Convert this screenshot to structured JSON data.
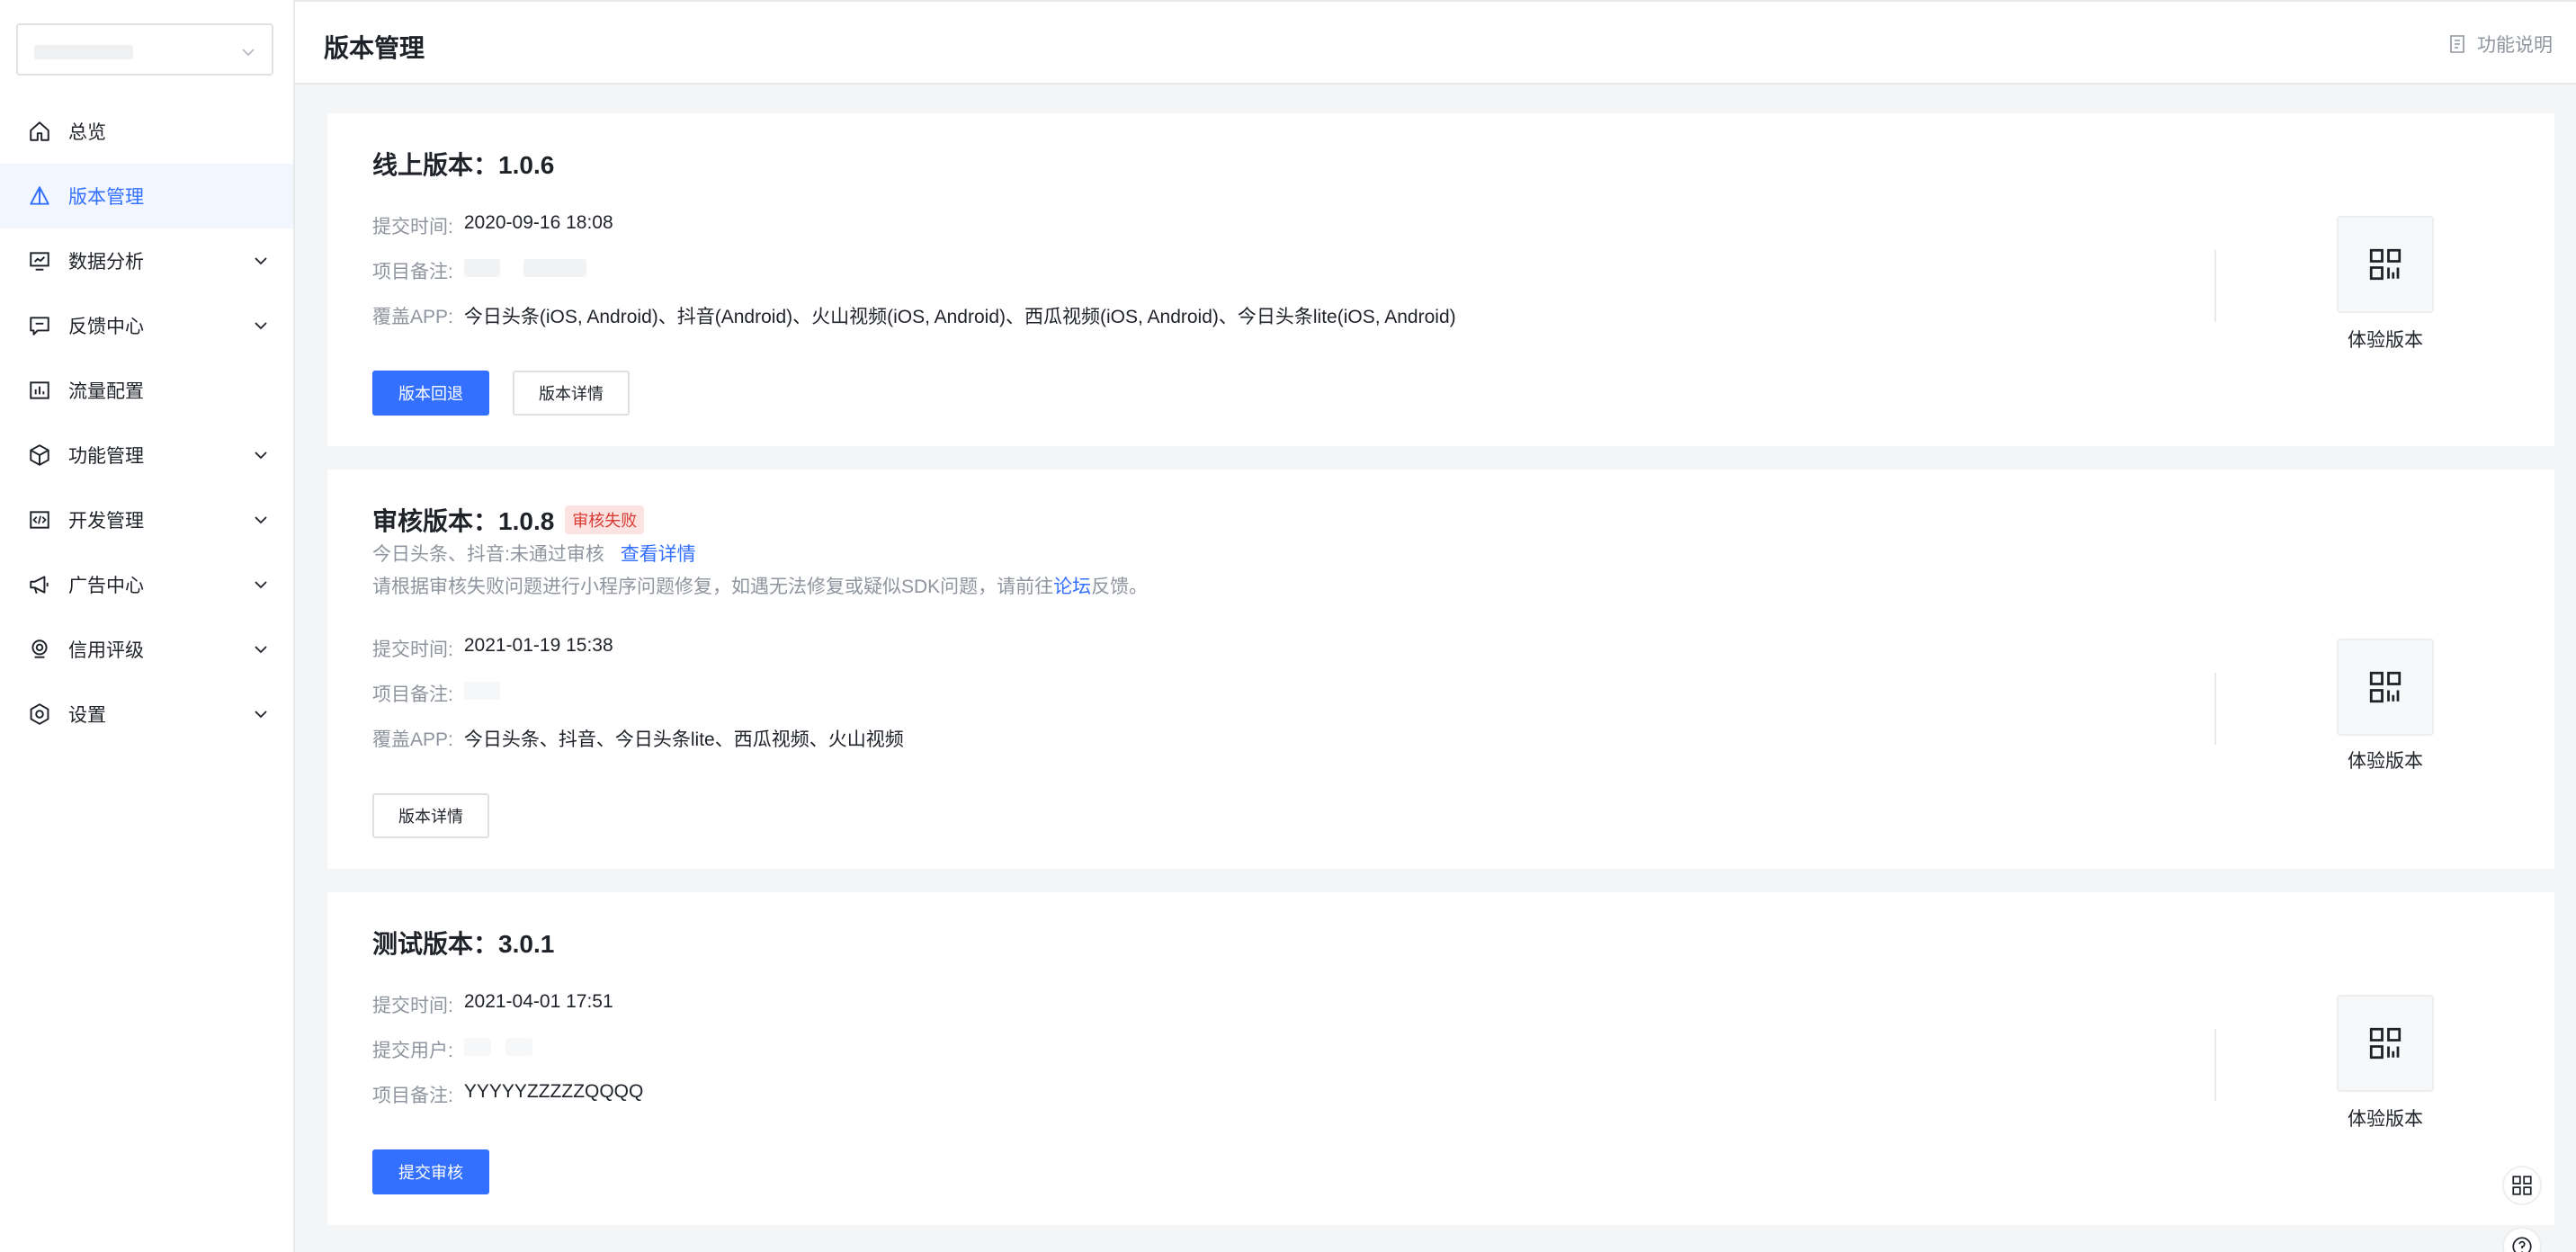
{
  "sidebar": {
    "items": [
      {
        "label": "总览",
        "icon": "home-icon",
        "active": false,
        "expandable": false
      },
      {
        "label": "版本管理",
        "icon": "version-icon",
        "active": true,
        "expandable": false
      },
      {
        "label": "数据分析",
        "icon": "analytics-icon",
        "active": false,
        "expandable": true
      },
      {
        "label": "反馈中心",
        "icon": "feedback-icon",
        "active": false,
        "expandable": true
      },
      {
        "label": "流量配置",
        "icon": "traffic-icon",
        "active": false,
        "expandable": false
      },
      {
        "label": "功能管理",
        "icon": "box-icon",
        "active": false,
        "expandable": true
      },
      {
        "label": "开发管理",
        "icon": "code-icon",
        "active": false,
        "expandable": true
      },
      {
        "label": "广告中心",
        "icon": "megaphone-icon",
        "active": false,
        "expandable": true
      },
      {
        "label": "信用评级",
        "icon": "badge-icon",
        "active": false,
        "expandable": true
      },
      {
        "label": "设置",
        "icon": "gear-icon",
        "active": false,
        "expandable": true
      }
    ]
  },
  "header": {
    "title": "版本管理",
    "help_label": "功能说明"
  },
  "online": {
    "title_prefix": "线上版本：",
    "version": "1.0.6",
    "submit_time_key": "提交时间:",
    "submit_time": "2020-09-16 18:08",
    "remark_key": "项目备注:",
    "apps_key": "覆盖APP:",
    "apps": "今日头条(iOS, Android)、抖音(Android)、火山视频(iOS, Android)、西瓜视频(iOS, Android)、今日头条lite(iOS, Android)",
    "rollback_label": "版本回退",
    "detail_label": "版本详情",
    "qr_label": "体验版本"
  },
  "review": {
    "title_prefix": "审核版本：",
    "version": "1.0.8",
    "badge": "审核失败",
    "fail_note": "今日头条、抖音:未通过审核",
    "view_detail": "查看详情",
    "advice_prefix": "请根据审核失败问题进行小程序问题修复，如遇无法修复或疑似SDK问题，请前往",
    "forum": "论坛",
    "advice_suffix": "反馈。",
    "submit_time_key": "提交时间:",
    "submit_time": "2021-01-19 15:38",
    "remark_key": "项目备注:",
    "apps_key": "覆盖APP:",
    "apps": "今日头条、抖音、今日头条lite、西瓜视频、火山视频",
    "detail_label": "版本详情",
    "qr_label": "体验版本"
  },
  "test": {
    "title_prefix": "测试版本：",
    "version": "3.0.1",
    "submit_time_key": "提交时间:",
    "submit_time": "2021-04-01 17:51",
    "user_key": "提交用户:",
    "remark_key": "项目备注:",
    "remark": "YYYYYZZZZZQQQQ",
    "submit_label": "提交审核",
    "qr_label": "体验版本"
  },
  "colors": {
    "accent": "#3370ff",
    "danger": "#d83931",
    "muted": "#8f959e"
  }
}
